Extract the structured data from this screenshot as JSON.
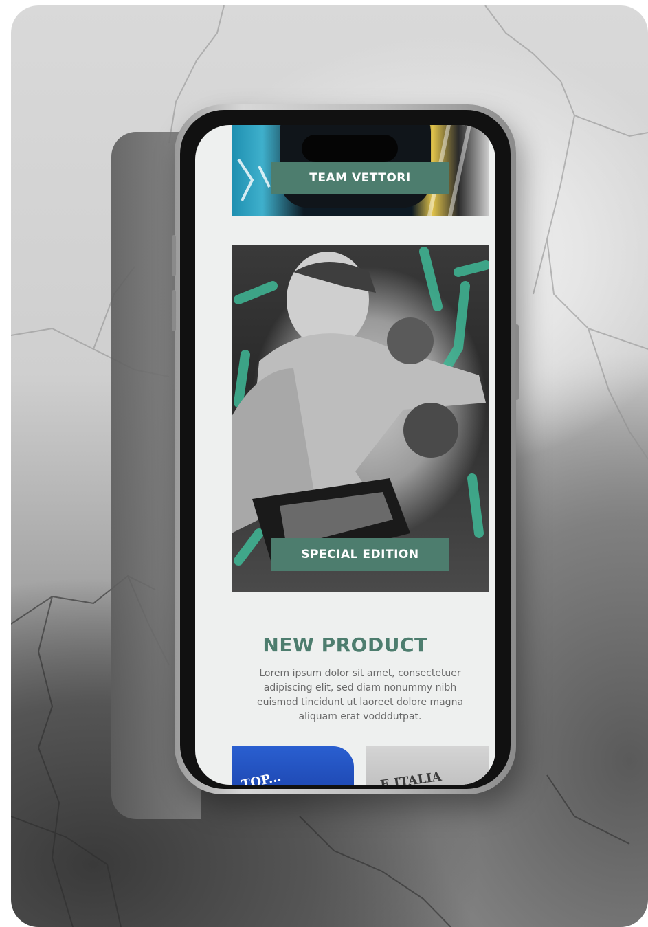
{
  "screen": {
    "banner_top": {
      "label": "TEAM VETTORI"
    },
    "banner_main": {
      "label": "SPECIAL EDITION"
    },
    "new_product": {
      "title": "NEW PRODUCT",
      "description_lines": [
        "Lorem ipsum dolor sit amet, consectetuer",
        "adipiscing elit, sed diam nonummy nibh",
        "euismod tincidunt ut laoreet dolore magna",
        "aliquam erat vodddutpat."
      ]
    },
    "thumbnails": [
      {
        "name": "blue-shirt",
        "partial_text": "TOP..."
      },
      {
        "name": "grey-shirt",
        "partial_text": "E.ITALIA"
      }
    ]
  },
  "colors": {
    "accent_green": "#4d7d6e",
    "screen_background": "#eef0ef"
  }
}
